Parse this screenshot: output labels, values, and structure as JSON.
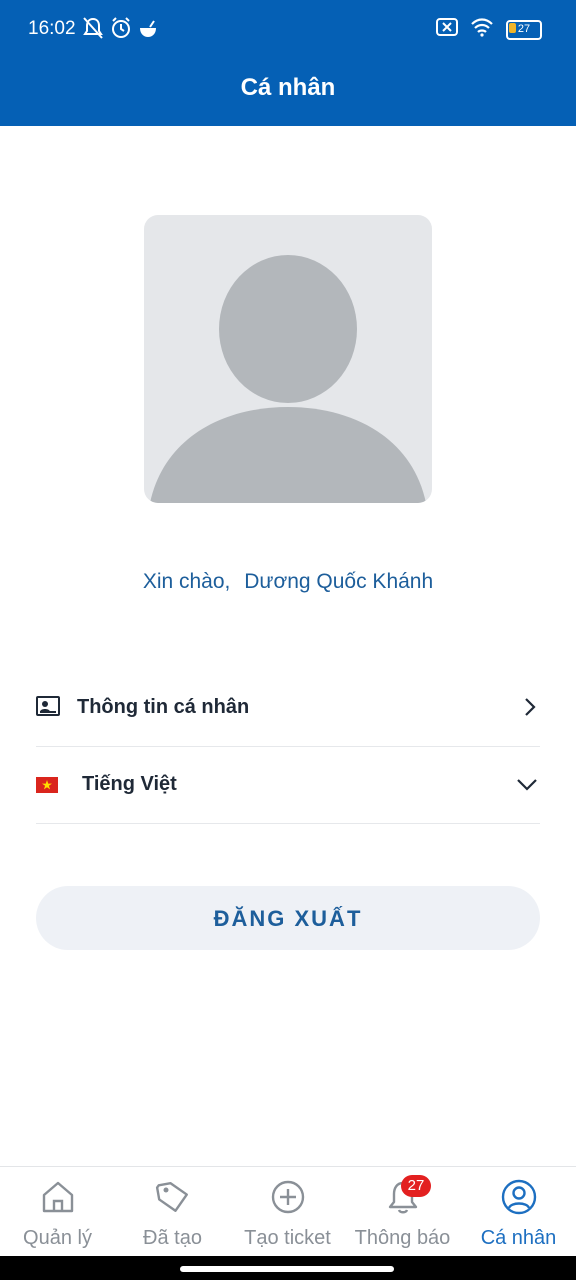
{
  "status_bar": {
    "time": "16:02",
    "battery": "27",
    "battery_level": 0.27,
    "icons_left": [
      "mute-bell-icon",
      "alarm-icon",
      "bowl-icon"
    ],
    "icons_right": [
      "sim-x-icon",
      "wifi-icon",
      "battery-icon"
    ]
  },
  "header": {
    "title": "Cá nhân"
  },
  "greeting": {
    "prefix": "Xin chào,",
    "name": "Dương Quốc Khánh"
  },
  "menu": {
    "personal_info": {
      "label": "Thông tin cá nhân",
      "icon": "id-card-icon"
    },
    "language": {
      "label": "Tiếng Việt",
      "icon": "vietnam-flag-icon"
    }
  },
  "logout": {
    "label": "ĐĂNG XUẤT"
  },
  "bottom_nav": {
    "items": [
      {
        "label": "Quản lý",
        "icon": "home-icon"
      },
      {
        "label": "Đã tạo",
        "icon": "tag-icon"
      },
      {
        "label": "Tạo ticket",
        "icon": "plus-circle-icon"
      },
      {
        "label": "Thông báo",
        "icon": "bell-icon"
      },
      {
        "label": "Cá nhân",
        "icon": "user-circle-icon"
      }
    ],
    "notification_count": "27",
    "active_index": 4
  },
  "colors": {
    "primary": "#0560b5",
    "accent_text": "#1d5e9b",
    "active_nav": "#1d6fc1",
    "badge": "#e32020"
  }
}
